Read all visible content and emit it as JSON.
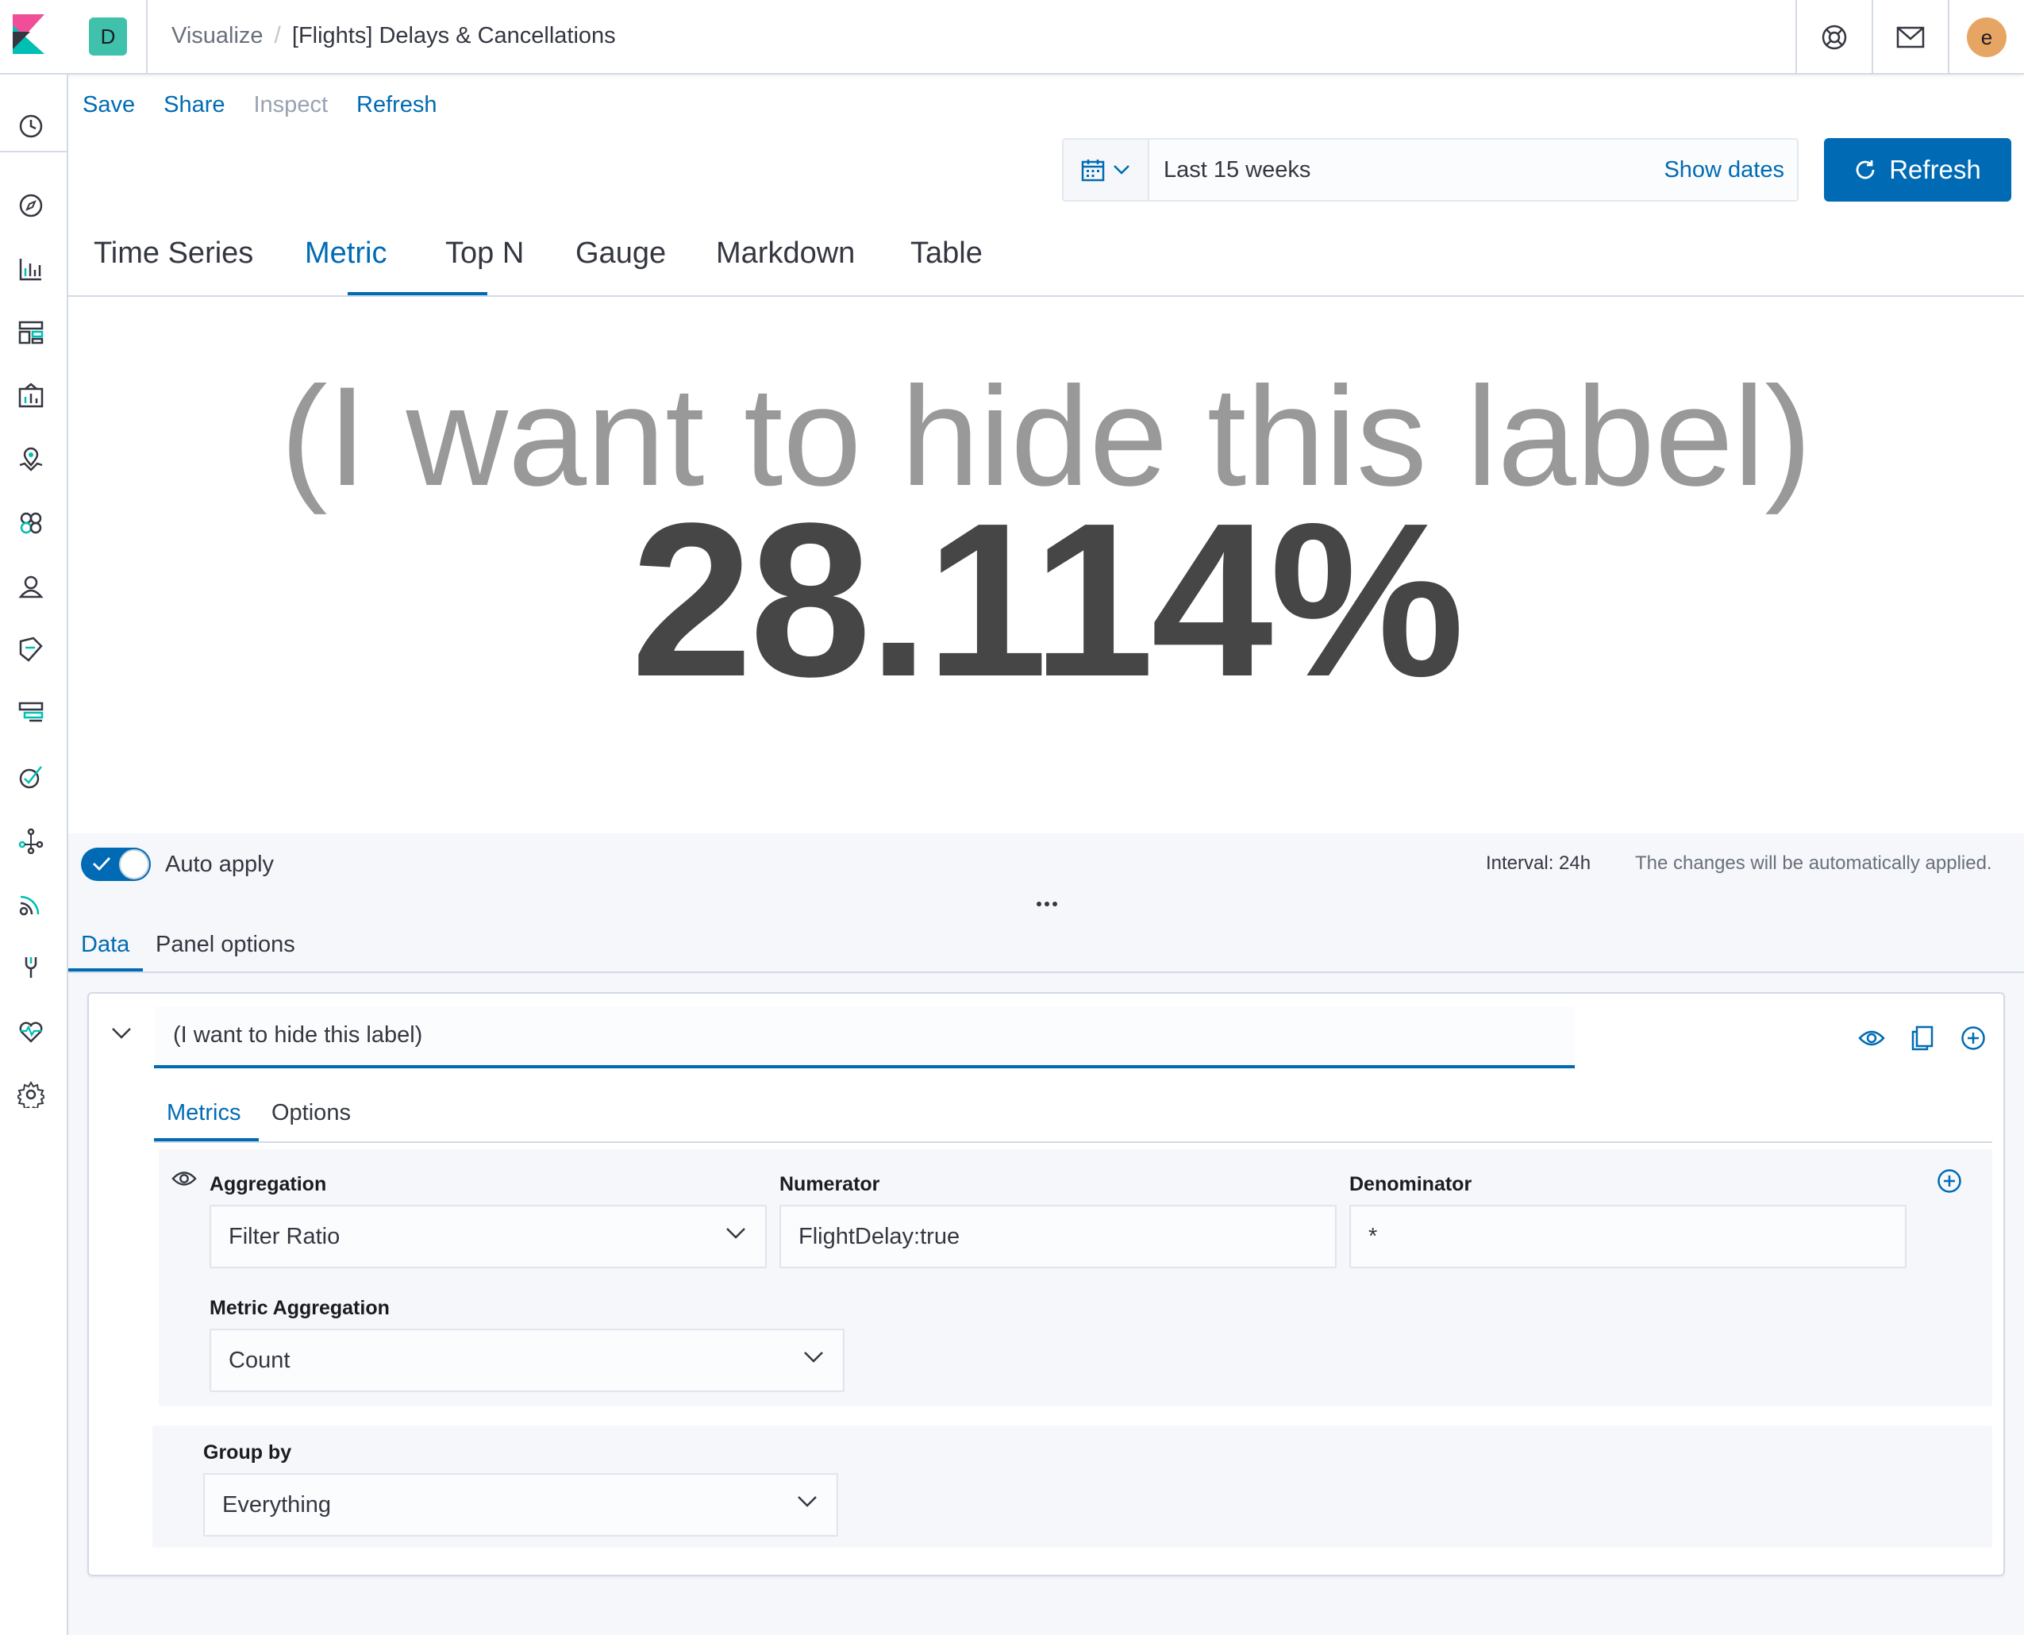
{
  "header": {
    "space_initial": "D",
    "breadcrumb_parent": "Visualize",
    "breadcrumb_separator": "/",
    "breadcrumb_current": "[Flights] Delays & Cancellations",
    "user_initial": "e"
  },
  "top_menu": {
    "save": "Save",
    "share": "Share",
    "inspect": "Inspect",
    "refresh": "Refresh"
  },
  "datepicker": {
    "range_text": "Last 15 weeks",
    "show_dates": "Show dates",
    "refresh_button": "Refresh"
  },
  "visualization_types": [
    "Time Series",
    "Metric",
    "Top N",
    "Gauge",
    "Markdown",
    "Table"
  ],
  "active_type": "Metric",
  "metric": {
    "label": "(I want to hide this label)",
    "value": "28.114%"
  },
  "editor": {
    "auto_apply_label": "Auto apply",
    "auto_apply_enabled": true,
    "interval": "Interval: 24h",
    "applied_note": "The changes will be automatically applied.",
    "tabs": [
      "Data",
      "Panel options"
    ],
    "series": {
      "label_value": "(I want to hide this label)",
      "sub_tabs": [
        "Metrics",
        "Options"
      ],
      "aggregation_label": "Aggregation",
      "aggregation_value": "Filter Ratio",
      "numerator_label": "Numerator",
      "numerator_value": "FlightDelay:true",
      "denominator_label": "Denominator",
      "denominator_value": "*",
      "metric_aggregation_label": "Metric Aggregation",
      "metric_aggregation_value": "Count",
      "group_by_label": "Group by",
      "group_by_value": "Everything"
    }
  },
  "colors": {
    "accent": "#006bb4",
    "space_badge": "#40c1ab",
    "avatar": "#e7a564",
    "metric_label": "#999999",
    "metric_value": "#464646"
  },
  "sidenav_icons": [
    "recently-viewed-icon",
    "discover-icon",
    "visualize-icon",
    "dashboard-icon",
    "canvas-icon",
    "maps-icon",
    "machine-learning-icon",
    "infrastructure-icon",
    "logs-icon",
    "apm-icon",
    "uptime-icon",
    "graph-icon",
    "siem-icon",
    "dev-tools-icon",
    "monitoring-icon",
    "management-icon"
  ]
}
